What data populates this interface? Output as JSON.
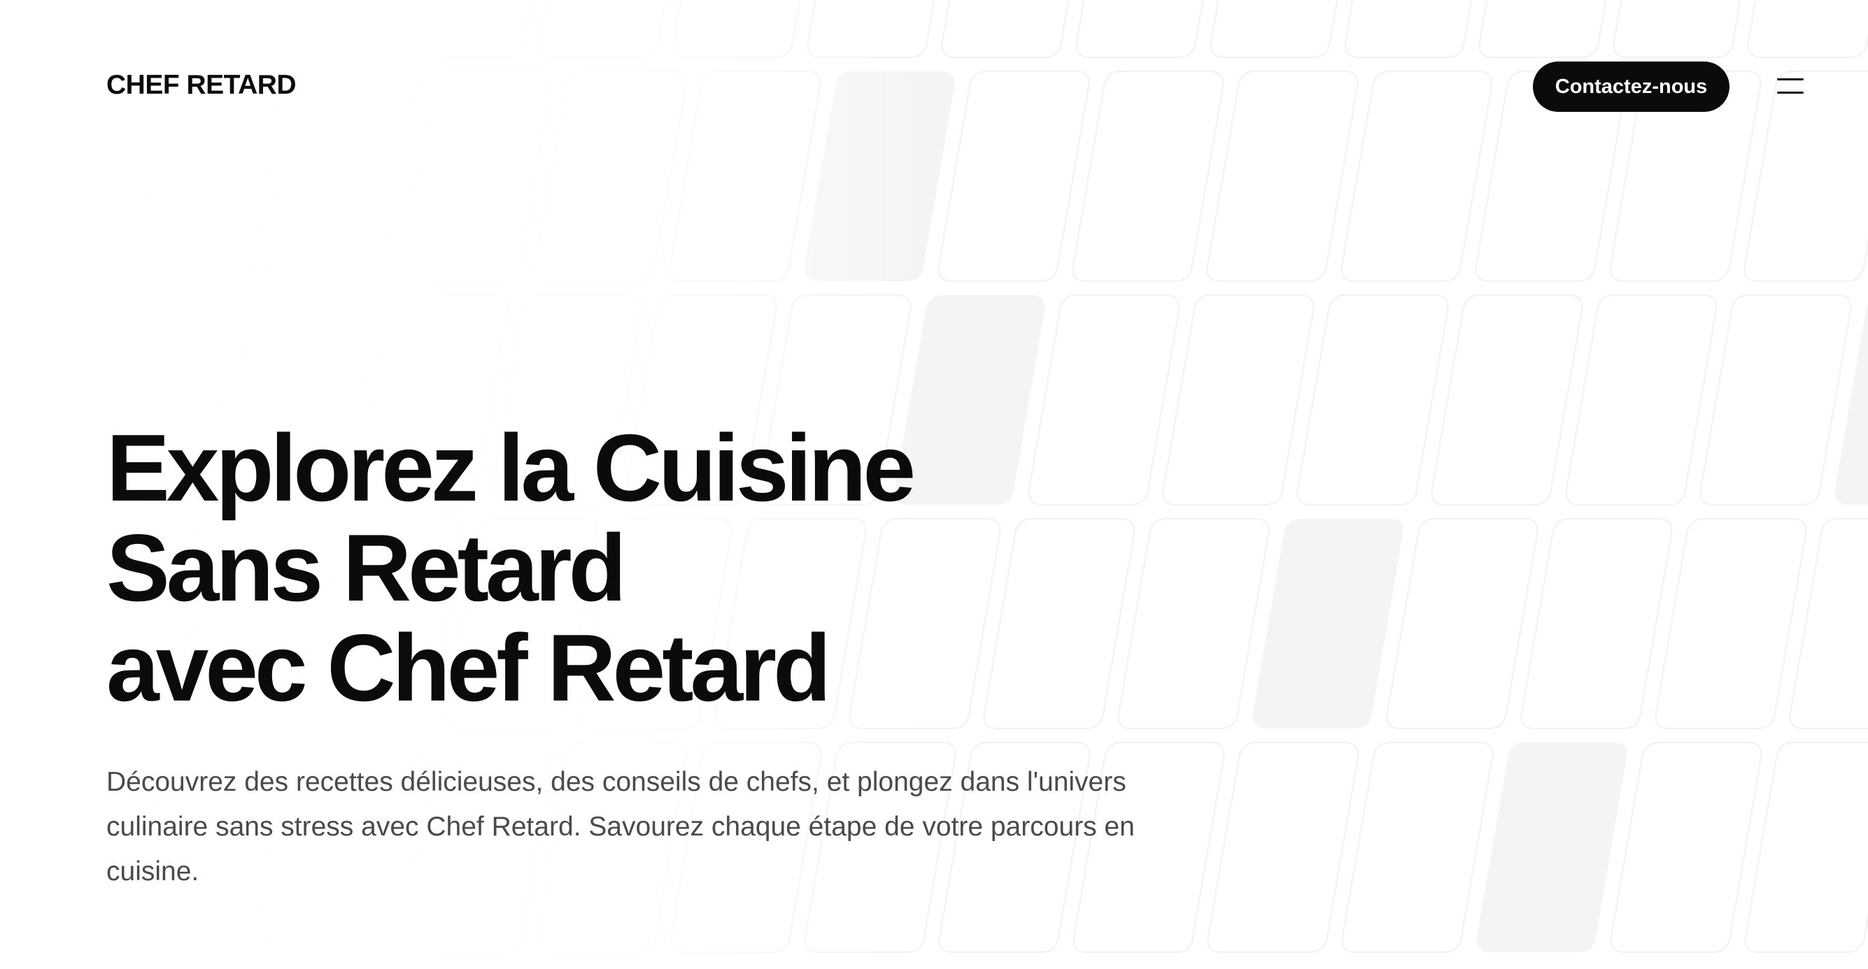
{
  "header": {
    "logo": "CHEF RETARD",
    "contact_label": "Contactez-nous",
    "menu_icon": "hamburger-menu-icon"
  },
  "hero": {
    "title_lines": [
      "Explorez la Cuisine",
      "Sans Retard",
      "avec Chef Retard"
    ],
    "description": "Découvrez des recettes délicieuses, des conseils de chefs, et plongez dans l'univers culinaire sans stress avec Chef Retard. Savourez chaque étape de votre parcours en cuisine."
  },
  "colors": {
    "background": "#ffffff",
    "text": "#0b0b0b",
    "button_bg": "#0b0b0b",
    "button_text": "#ffffff",
    "description_text": "#4a4a4a",
    "tile_outline": "#f1f1f1",
    "tile_fill": "#f4f4f4"
  }
}
